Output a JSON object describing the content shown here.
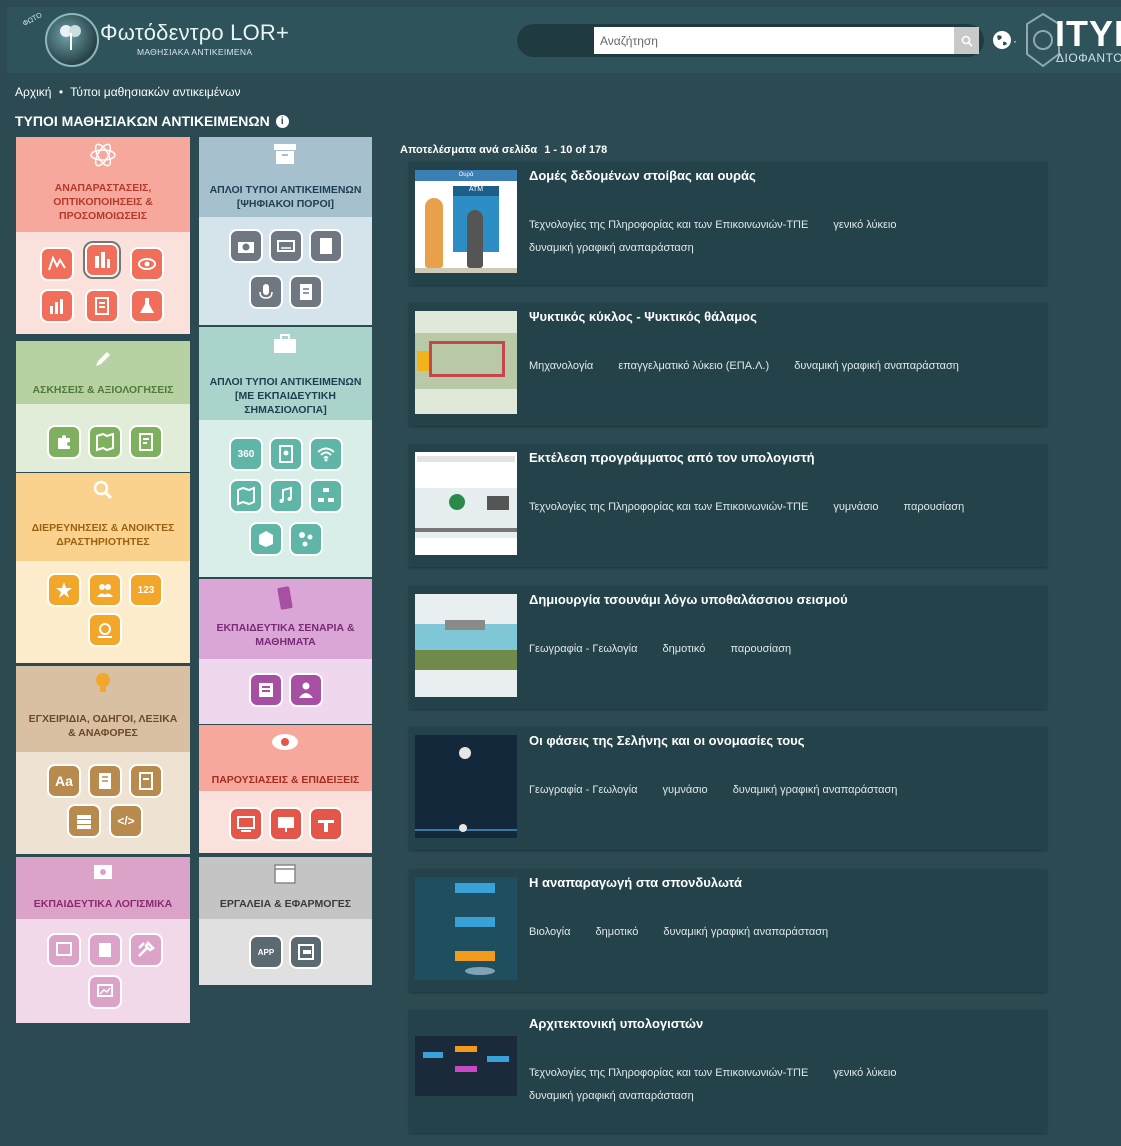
{
  "header": {
    "logo_title": "Φωτόδεντρο LOR+",
    "logo_subtitle": "ΜΑΘΗΣΙΑΚΑ ΑΝΤΙΚΕΙΜΕΝΑ",
    "logo_badge": "ΦΩΤΟ",
    "search_placeholder": "Αναζήτηση",
    "lang_dot": "·",
    "org_name": "ITYE",
    "org_sub": "ΔΙΟΦΑΝΤΟΣ"
  },
  "breadcrumb": {
    "home": "Αρχική",
    "separator": "•",
    "current": "Τύποι μαθησιακών αντικειμένων"
  },
  "page_title": "ΤΥΠΟΙ ΜΑΘΗΣΙΑΚΩΝ ΑΝΤΙΚΕΙΜΕΝΩΝ",
  "info_glyph": "i",
  "categories": [
    {
      "title": "ΑΝΑΠΑΡΑΣΤΑΣΕΙΣ, ΟΠΤΙΚΟΠΟΙΗΣΕΙΣ & ΠΡΟΣΟΜΟΙΩΣΕΙΣ",
      "icon": "atom-icon",
      "head_color": "#f5a89b",
      "body_color": "#fbe1dc",
      "icon_color": "#f06e5a"
    },
    {
      "title": "ΑΠΛΟΙ ΤΥΠΟΙ ΑΝΤΙΚΕΙΜΕΝΩΝ [ΨΗΦΙΑΚΟΙ ΠΟΡΟΙ]",
      "icon": "archive-box-icon",
      "head_color": "#a6c0cd",
      "body_color": "#d5e3ea",
      "icon_color": "#6f7780"
    },
    {
      "title": "ΑΣΚΗΣΕΙΣ & ΑΞΙΟΛΟΓΗΣΕΙΣ",
      "icon": "pencil-icon",
      "head_color": "#b7d1a3",
      "body_color": "#e1edd8",
      "icon_color": "#7fb05f"
    },
    {
      "title": "ΑΠΛΟΙ ΤΥΠΟΙ ΑΝΤΙΚΕΙΜΕΝΩΝ [ΜΕ ΕΚΠΑΙΔΕΥΤΙΚΗ ΣΗΜΑΣΙΟΛΟΓΙΑ]",
      "icon": "briefcase-icon",
      "head_color": "#a9d3cb",
      "body_color": "#d9ede9",
      "icon_color": "#5fb5a6"
    },
    {
      "title": "ΔΙΕΡΕΥΝΗΣΕΙΣ & ΑΝΟΙΚΤΕΣ ΔΡΑΣΤΗΡΙΟΤΗΤΕΣ",
      "icon": "magnifier-icon",
      "head_color": "#fad28d",
      "body_color": "#fdeccb",
      "icon_color": "#f2a72a"
    },
    {
      "title": "ΕΚΠΑΙΔΕΥΤΙΚΑ ΣΕΝΑΡΙΑ & ΜΑΘΗΜΑΤΑ",
      "icon": "scroll-icon",
      "head_color": "#d9a6d6",
      "body_color": "#efd7ee",
      "icon_color": "#a64fa3"
    },
    {
      "title": "ΕΓΧΕΙΡΙΔΙΑ, ΟΔΗΓΟΙ, ΛΕΞΙΚΑ & ΑΝΑΦΟΡΕΣ",
      "icon": "lightbulb-icon",
      "head_color": "#d9c0a3",
      "body_color": "#eee2d2",
      "icon_color": "#b88a4e"
    },
    {
      "title": "ΠΑΡΟΥΣΙΑΣΕΙΣ & ΕΠΙΔΕΙΞΕΙΣ",
      "icon": "eye-icon",
      "head_color": "#f5a89b",
      "body_color": "#fbe1dc",
      "icon_color": "#e4564a"
    },
    {
      "title": "ΕΚΠΑΙΔΕΥΤΙΚΑ ΛΟΓΙΣΜΙΚΑ",
      "icon": "monitor-gear-icon",
      "head_color": "#dca3c9",
      "body_color": "#f1d9e9",
      "icon_color": "#c262a3"
    },
    {
      "title": "ΕΡΓΑΛΕΙΑ & ΕΦΑΡΜΟΓΕΣ",
      "icon": "window-icon",
      "head_color": "#c4c4c4",
      "body_color": "#e0e0e0",
      "icon_color": "#5a6a70"
    }
  ],
  "tile_icon_text": {
    "360": "360",
    "aa": "Aa",
    "code": "</>",
    "num": "123",
    "app": "APP"
  },
  "results": {
    "label": "Αποτελέσματα ανά σελίδα",
    "range": "1 - 10 of 178",
    "items": [
      {
        "title": "Δομές δεδομένων στοίβας και ουράς",
        "thumb_label": "Ουρά",
        "thumb_atm": "ATM",
        "tags": [
          "Τεχνολογίες της Πληροφορίας και των Επικοινωνιών-ΤΠΕ",
          "γενικό λύκειο",
          "δυναμική γραφική αναπαράσταση"
        ]
      },
      {
        "title": "Ψυκτικός κύκλος - Ψυκτικός θάλαμος",
        "tags": [
          "Μηχανολογία",
          "επαγγελματικό λύκειο (ΕΠΑ.Λ.)",
          "δυναμική γραφική αναπαράσταση"
        ]
      },
      {
        "title": "Εκτέλεση προγράμματος από τον υπολογιστή",
        "tags": [
          "Τεχνολογίες της Πληροφορίας και των Επικοινωνιών-ΤΠΕ",
          "γυμνάσιο",
          "παρουσίαση"
        ]
      },
      {
        "title": "Δημιουργία τσουνάμι λόγω υποθαλάσσιου σεισμού",
        "tags": [
          "Γεωγραφία - Γεωλογία",
          "δημοτικό",
          "παρουσίαση"
        ]
      },
      {
        "title": "Οι φάσεις της Σελήνης και οι ονομασίες τους",
        "tags": [
          "Γεωγραφία - Γεωλογία",
          "γυμνάσιο",
          "δυναμική γραφική αναπαράσταση"
        ]
      },
      {
        "title": "Η αναπαραγωγή στα σπονδυλωτά",
        "tags": [
          "Βιολογία",
          "δημοτικό",
          "δυναμική γραφική αναπαράσταση"
        ]
      },
      {
        "title": "Αρχιτεκτονική υπολογιστών",
        "tags": [
          "Τεχνολογίες της Πληροφορίας και των Επικοινωνιών-ΤΠΕ",
          "γενικό λύκειο",
          "δυναμική γραφική αναπαράσταση"
        ]
      }
    ]
  }
}
